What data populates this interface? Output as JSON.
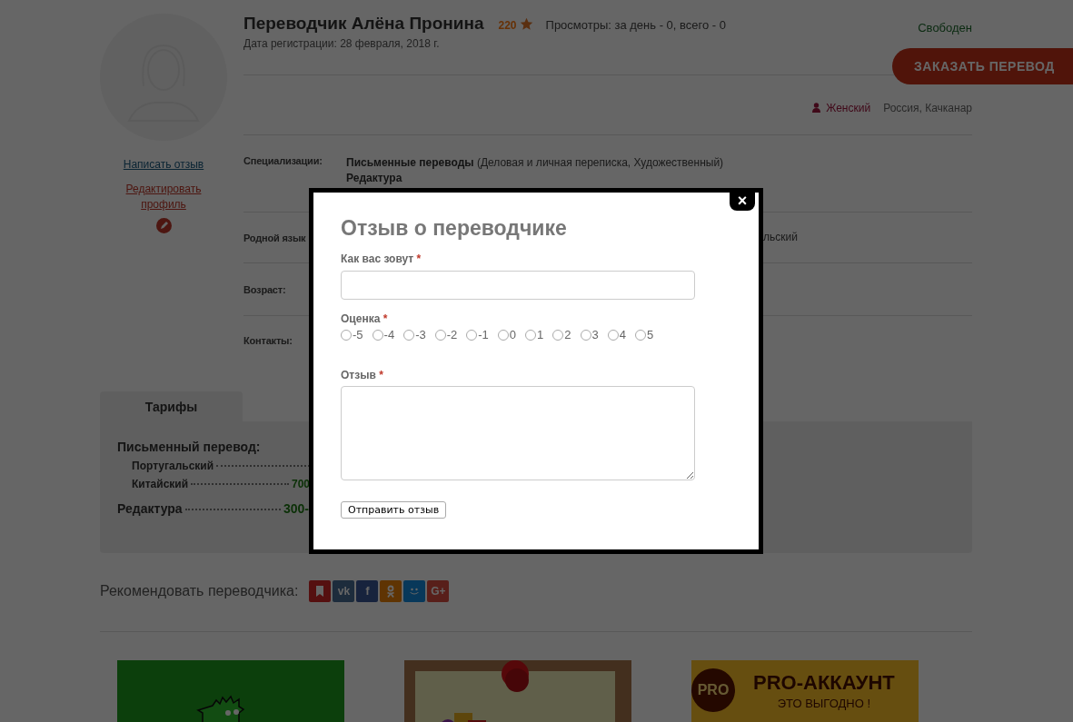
{
  "profile": {
    "links": [
      {
        "text": "Написать отзыв",
        "kind": "write"
      },
      {
        "text": "Редактировать профиль",
        "kind": "edit"
      }
    ]
  },
  "header": {
    "name": "Переводчик Алёна Пронина",
    "rating": "220",
    "views": "Просмотры: за день - 0, всего - 0",
    "registered": "Дата регистрации: 28 февраля, 2018 г.",
    "status": "Свободен",
    "order_button": "ЗАКАЗАТЬ ПЕРЕВОД",
    "gender": "Женский",
    "location": "Россия, Качканар"
  },
  "details": [
    {
      "label": "Специализации:",
      "lines": [
        "**Письменные переводы** (Деловая и личная переписка, Художественный)",
        "**Редактура**"
      ]
    },
    {
      "label": "Родной язык",
      "lines": [
        "льский"
      ],
      "kind": "covered"
    },
    {
      "label": "Возраст:"
    },
    {
      "label": "Контакты:"
    }
  ],
  "tariffs": {
    "tab": "Тарифы",
    "groups": [
      {
        "title": "Письменный перевод:",
        "items": [
          {
            "name": "Португальский"
          },
          {
            "name": "Китайский",
            "price": "700"
          }
        ]
      },
      {
        "title": "Редактура",
        "price": "300-"
      }
    ]
  },
  "recommend": {
    "label": "Рекомендовать переводчика:",
    "buttons": [
      {
        "kind": "bookmark"
      },
      {
        "kind": "vk",
        "label": "vk"
      },
      {
        "kind": "fb",
        "label": "f"
      },
      {
        "kind": "ok"
      },
      {
        "kind": "smile"
      },
      {
        "kind": "gplus",
        "label": "G+"
      }
    ]
  },
  "banners": [
    {
      "kind": "picture"
    },
    {
      "kind": "picture"
    },
    {
      "kind": "pro",
      "badge": "PRO",
      "title": "PRO-АККАУНТ",
      "subtitle": "ЭТО ВЫГОДНО !"
    }
  ],
  "review_form": {
    "close": "×",
    "title": "Отзыв о переводчике",
    "name_field": {
      "label": "Как вас зовут",
      "required_mark": "*"
    },
    "rating": {
      "label": "Оценка",
      "required_mark": "*",
      "options": [
        {
          "label": "-5",
          "selected": false
        },
        {
          "label": "-4",
          "selected": false
        },
        {
          "label": "-3",
          "selected": false
        },
        {
          "label": "-2",
          "selected": false
        },
        {
          "label": "-1",
          "selected": false
        },
        {
          "label": "0",
          "selected": false
        },
        {
          "label": "1",
          "selected": false
        },
        {
          "label": "2",
          "selected": false
        },
        {
          "label": "3",
          "selected": false
        },
        {
          "label": "4",
          "selected": false
        },
        {
          "label": "5",
          "selected": false
        }
      ]
    },
    "review_field": {
      "label": "Отзыв",
      "required_mark": "*"
    },
    "submit": "Отправить отзыв"
  }
}
